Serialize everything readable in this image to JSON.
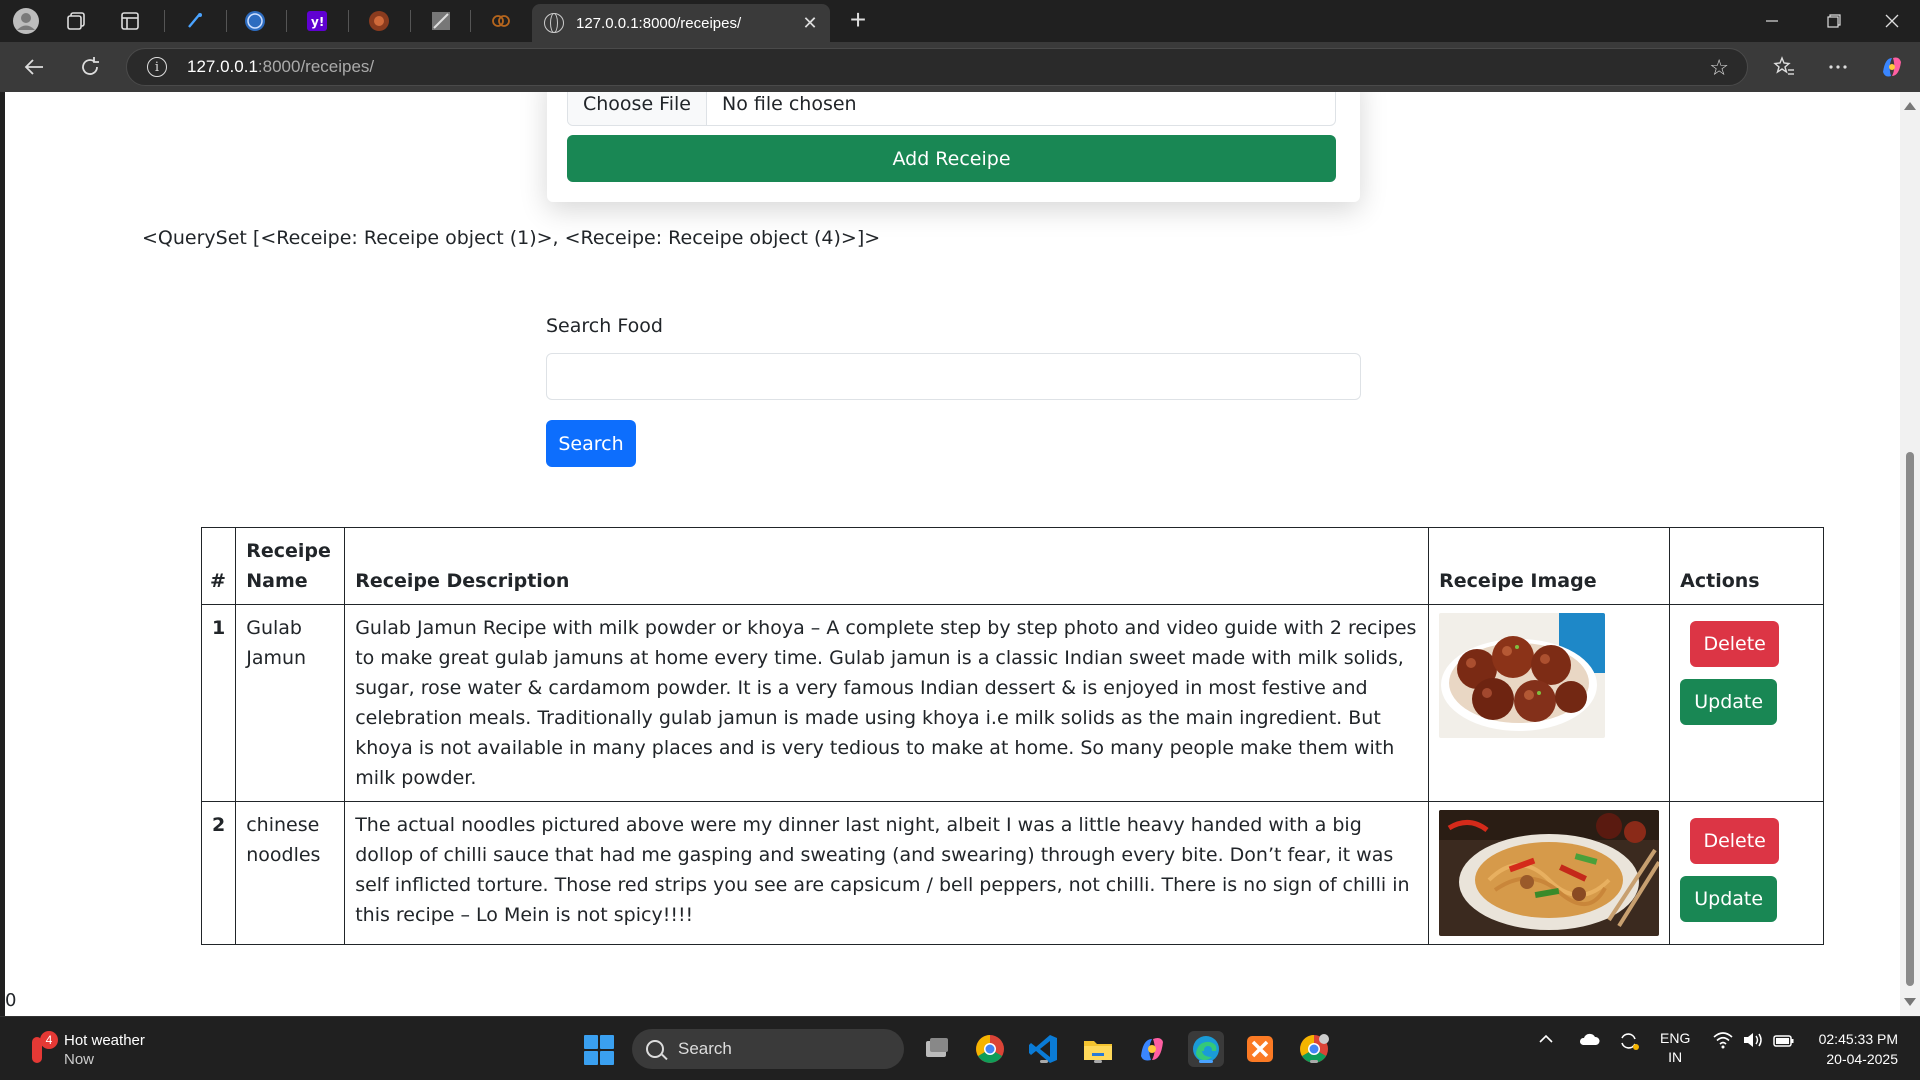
{
  "browser": {
    "active_tab_title": "127.0.0.1:8000/receipes/",
    "url_host": "127.0.0.1",
    "url_rest": ":8000/receipes/"
  },
  "form": {
    "file_button": "Choose File",
    "file_status": "No file chosen",
    "submit_label": "Add Receipe"
  },
  "queryset_text": "<QuerySet [<Receipe: Receipe object (1)>, <Receipe: Receipe object (4)>]>",
  "search": {
    "label": "Search Food",
    "value": "",
    "button": "Search"
  },
  "table": {
    "headers": [
      "#",
      "Receipe Name",
      "Receipe Description",
      "Receipe Image",
      "Actions"
    ],
    "rows": [
      {
        "num": "1",
        "name": "Gulab Jamun",
        "description": "Gulab Jamun Recipe with milk powder or khoya – A complete step by step photo and video guide with 2 recipes to make great gulab jamuns at home every time. Gulab jamun is a classic Indian sweet made with milk solids, sugar, rose water & cardamom powder. It is a very famous Indian dessert & is enjoyed in most festive and celebration meals. Traditionally gulab jamun is made using khoya i.e milk solids as the main ingredient. But khoya is not available in many places and is very tedious to make at home. So many people make them with milk powder.",
        "delete": "Delete",
        "update": "Update"
      },
      {
        "num": "2",
        "name": "chinese noodles",
        "description": "The actual noodles pictured above were my dinner last night, albeit I was a little heavy handed with a big dollop of chilli sauce that had me gasping and sweating (and swearing) through every bite. Don’t fear, it was self inflicted torture. Those red strips you see are capsicum / bell peppers, not chilli. There is no sign of chilli in this recipe – Lo Mein is not spicy!!!!",
        "delete": "Delete",
        "update": "Update"
      }
    ]
  },
  "page_footer_text": "0",
  "taskbar": {
    "weather_title": "Hot weather",
    "weather_sub": "Now",
    "weather_badge": "4",
    "search_label": "Search",
    "lang_line1": "ENG",
    "lang_line2": "IN",
    "time": "02:45:33 PM",
    "date": "20-04-2025"
  },
  "colors": {
    "primary": "#0d6efd",
    "success": "#198754",
    "danger": "#dc3545"
  }
}
